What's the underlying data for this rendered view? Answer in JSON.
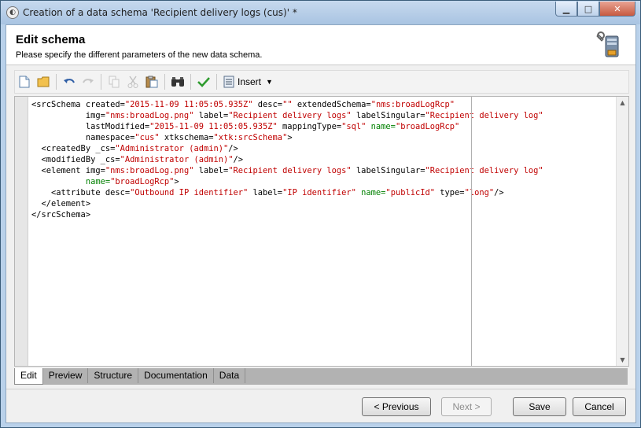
{
  "window": {
    "title": "Creation of a data schema 'Recipient delivery logs (cus)' *",
    "controls": {
      "minimize": "▁",
      "maximize": "□",
      "close": "✕"
    }
  },
  "header": {
    "title": "Edit schema",
    "subtitle": "Please specify the different parameters of the new data schema."
  },
  "toolbar": {
    "insert_label": "Insert",
    "icons": [
      "new-document-icon",
      "open-folder-icon",
      "undo-icon",
      "redo-icon",
      "copy-icon",
      "cut-icon",
      "paste-icon",
      "find-icon",
      "validate-icon",
      "insert-icon"
    ]
  },
  "editor": {
    "lines": [
      [
        [
          "p",
          "<srcSchema "
        ],
        [
          "a",
          "created="
        ],
        [
          "s",
          "\"2015-11-09 11:05:05.935Z\""
        ],
        [
          "a",
          " desc="
        ],
        [
          "s",
          "\"\""
        ],
        [
          "a",
          " extendedSchema="
        ],
        [
          "s",
          "\"nms:broadLogRcp\""
        ]
      ],
      [
        [
          "a",
          "           img="
        ],
        [
          "s",
          "\"nms:broadLog.png\""
        ],
        [
          "a",
          " label="
        ],
        [
          "s",
          "\"Recipient delivery logs\""
        ],
        [
          "a",
          " labelSingular="
        ],
        [
          "s",
          "\"Recipient delivery log\""
        ]
      ],
      [
        [
          "a",
          "           lastModified="
        ],
        [
          "s",
          "\"2015-11-09 11:05:05.935Z\""
        ],
        [
          "a",
          " mappingType="
        ],
        [
          "s",
          "\"sql\""
        ],
        [
          "n",
          " name="
        ],
        [
          "s",
          "\"broadLogRcp\""
        ]
      ],
      [
        [
          "a",
          "           namespace="
        ],
        [
          "s",
          "\"cus\""
        ],
        [
          "a",
          " xtkschema="
        ],
        [
          "s",
          "\"xtk:srcSchema\""
        ],
        [
          "p",
          ">"
        ]
      ],
      [
        [
          "p",
          "  <createdBy "
        ],
        [
          "a",
          "_cs="
        ],
        [
          "s",
          "\"Administrator (admin)\""
        ],
        [
          "p",
          "/>"
        ]
      ],
      [
        [
          "p",
          "  <modifiedBy "
        ],
        [
          "a",
          "_cs="
        ],
        [
          "s",
          "\"Administrator (admin)\""
        ],
        [
          "p",
          "/>"
        ]
      ],
      [
        [
          "p",
          "  <element "
        ],
        [
          "a",
          "img="
        ],
        [
          "s",
          "\"nms:broadLog.png\""
        ],
        [
          "a",
          " label="
        ],
        [
          "s",
          "\"Recipient delivery logs\""
        ],
        [
          "a",
          " labelSingular="
        ],
        [
          "s",
          "\"Recipient delivery log\""
        ]
      ],
      [
        [
          "n",
          "           name="
        ],
        [
          "s",
          "\"broadLogRcp\""
        ],
        [
          "p",
          ">"
        ]
      ],
      [
        [
          "p",
          "    <attribute "
        ],
        [
          "a",
          "desc="
        ],
        [
          "s",
          "\"Outbound IP identifier\""
        ],
        [
          "a",
          " label="
        ],
        [
          "s",
          "\"IP identifier\""
        ],
        [
          "n",
          " name="
        ],
        [
          "s",
          "\"publicId\""
        ],
        [
          "a",
          " type="
        ],
        [
          "s",
          "\"long\""
        ],
        [
          "p",
          "/>"
        ]
      ],
      [
        [
          "p",
          "  </element>"
        ]
      ],
      [
        [
          "p",
          "</srcSchema>"
        ]
      ]
    ]
  },
  "tabs": [
    {
      "label": "Edit",
      "active": true
    },
    {
      "label": "Preview",
      "active": false
    },
    {
      "label": "Structure",
      "active": false
    },
    {
      "label": "Documentation",
      "active": false
    },
    {
      "label": "Data",
      "active": false
    }
  ],
  "buttons": {
    "previous": "< Previous",
    "next": "Next >",
    "save": "Save",
    "cancel": "Cancel"
  }
}
